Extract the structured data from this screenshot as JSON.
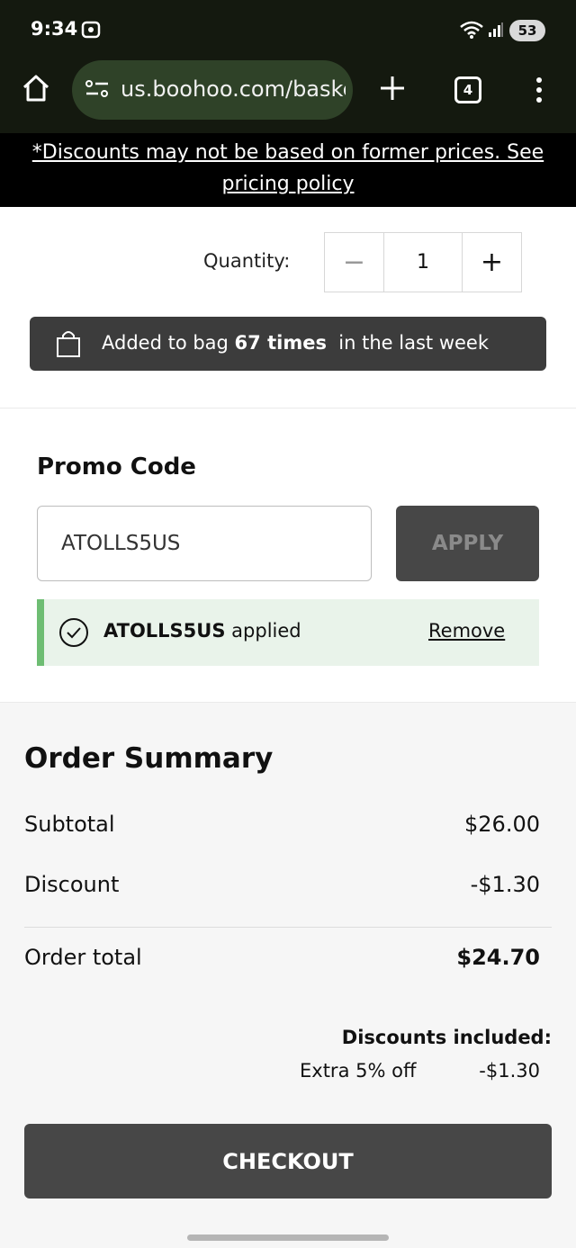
{
  "status_bar": {
    "time": "9:34",
    "battery": "53"
  },
  "browser": {
    "url": "us.boohoo.com/basket",
    "tab_count": "4"
  },
  "banner": {
    "text": "*Discounts may not be based on former prices. See pricing policy"
  },
  "quantity": {
    "label": "Quantity:",
    "value": "1",
    "minus": "−",
    "plus": "+"
  },
  "bag_notice": {
    "prefix": "Added to bag ",
    "count": "67 times",
    "suffix": "  in the last week"
  },
  "promo": {
    "title": "Promo Code",
    "input_value": "ATOLLS5US",
    "apply_label": "APPLY",
    "applied_code": "ATOLLS5US",
    "applied_suffix": " applied",
    "remove_label": "Remove"
  },
  "order_summary": {
    "title": "Order Summary",
    "subtotal_label": "Subtotal",
    "subtotal_value": "$26.00",
    "discount_label": "Discount",
    "discount_value": "-$1.30",
    "total_label": "Order total",
    "total_value": "$24.70",
    "discounts_included_label": "Discounts included:",
    "discount_item_name": "Extra 5% off",
    "discount_item_value": "-$1.30",
    "checkout_label": "CHECKOUT"
  }
}
